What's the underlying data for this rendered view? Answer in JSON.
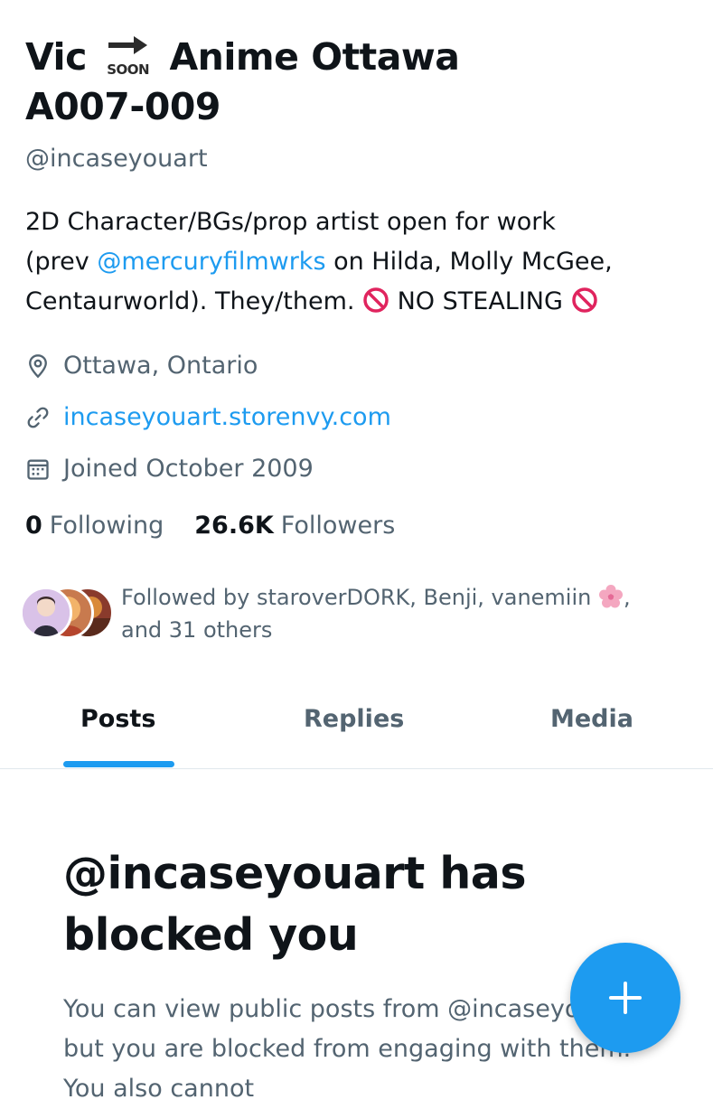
{
  "profile": {
    "name_before": "Vic",
    "name_emoji_text": "SOON",
    "name_after": "Anime Ottawa",
    "name_line2": "A007-009",
    "handle": "@incaseyouart",
    "bio": {
      "line1": "2D Character/BGs/prop artist open for work",
      "prev_prefix": "(prev ",
      "mention": "@mercuryfilmwrks",
      "prev_suffix": " on Hilda, Molly McGee,",
      "line3_text": "Centaurworld). They/them. ",
      "no_stealing": " NO STEALING "
    },
    "location": "Ottawa, Ontario",
    "website": "incaseyouart.storenvy.com",
    "joined": "Joined October 2009",
    "following_count": "0",
    "following_label": "Following",
    "followers_count": "26.6K",
    "followers_label": "Followers",
    "followed_by_prefix": "Followed by staroverDORK, Benji, vanemiin ",
    "followed_by_suffix": ",",
    "followed_by_line2": "and 31 others"
  },
  "tabs": [
    {
      "label": "Posts",
      "active": true
    },
    {
      "label": "Replies",
      "active": false
    },
    {
      "label": "Media",
      "active": false
    }
  ],
  "blocked": {
    "title": "@incaseyouart has blocked you",
    "message": "You can view public posts from @incaseyouart, but you are blocked from engaging with them. You also cannot"
  },
  "icons": {
    "location": "location-pin-icon",
    "link": "link-icon",
    "calendar": "calendar-icon",
    "fab": "plus-icon",
    "no_entry": "prohibited-emoji-icon",
    "flower": "cherry-blossom-emoji-icon",
    "soon": "soon-arrow-emoji-icon"
  },
  "colors": {
    "accent": "#1d9bf0",
    "text_primary": "#0f1419",
    "text_secondary": "#536471"
  }
}
